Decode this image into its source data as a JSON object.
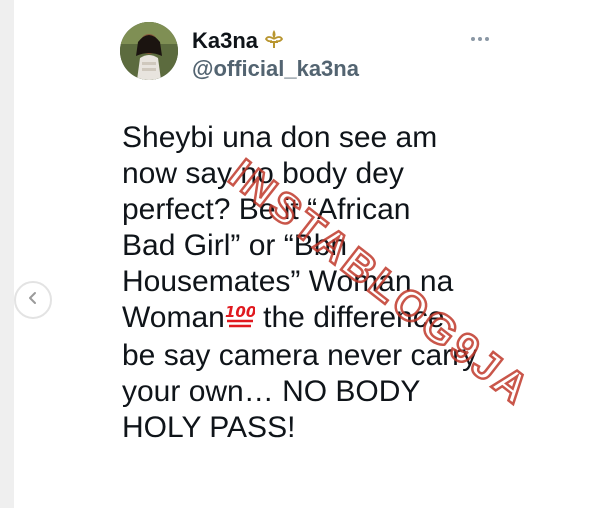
{
  "profile": {
    "display_name": "Ka3na",
    "handle": "@official_ka3na",
    "badge_icon": "fleur-de-lis-icon",
    "badge_color": "#b8952f"
  },
  "tweet": {
    "line1": "Sheybi una don see am",
    "line2": "now say no body dey",
    "line3": "perfect? Be it “African",
    "line4": "Bad Girl” or “Bbn",
    "line5": "Housemates” Woman na",
    "line6_pre": "Woman",
    "line6_emoji": "💯",
    "line6_post": " the difference",
    "line7": "be say camera never carry",
    "line8": "your own… NO BODY",
    "line9": "HOLY PASS!"
  },
  "watermark": {
    "text": "INSTABLOG9JA",
    "color": "#c0392b"
  },
  "controls": {
    "more_icon": "ellipsis-icon",
    "prev_icon": "chevron-left-icon"
  }
}
